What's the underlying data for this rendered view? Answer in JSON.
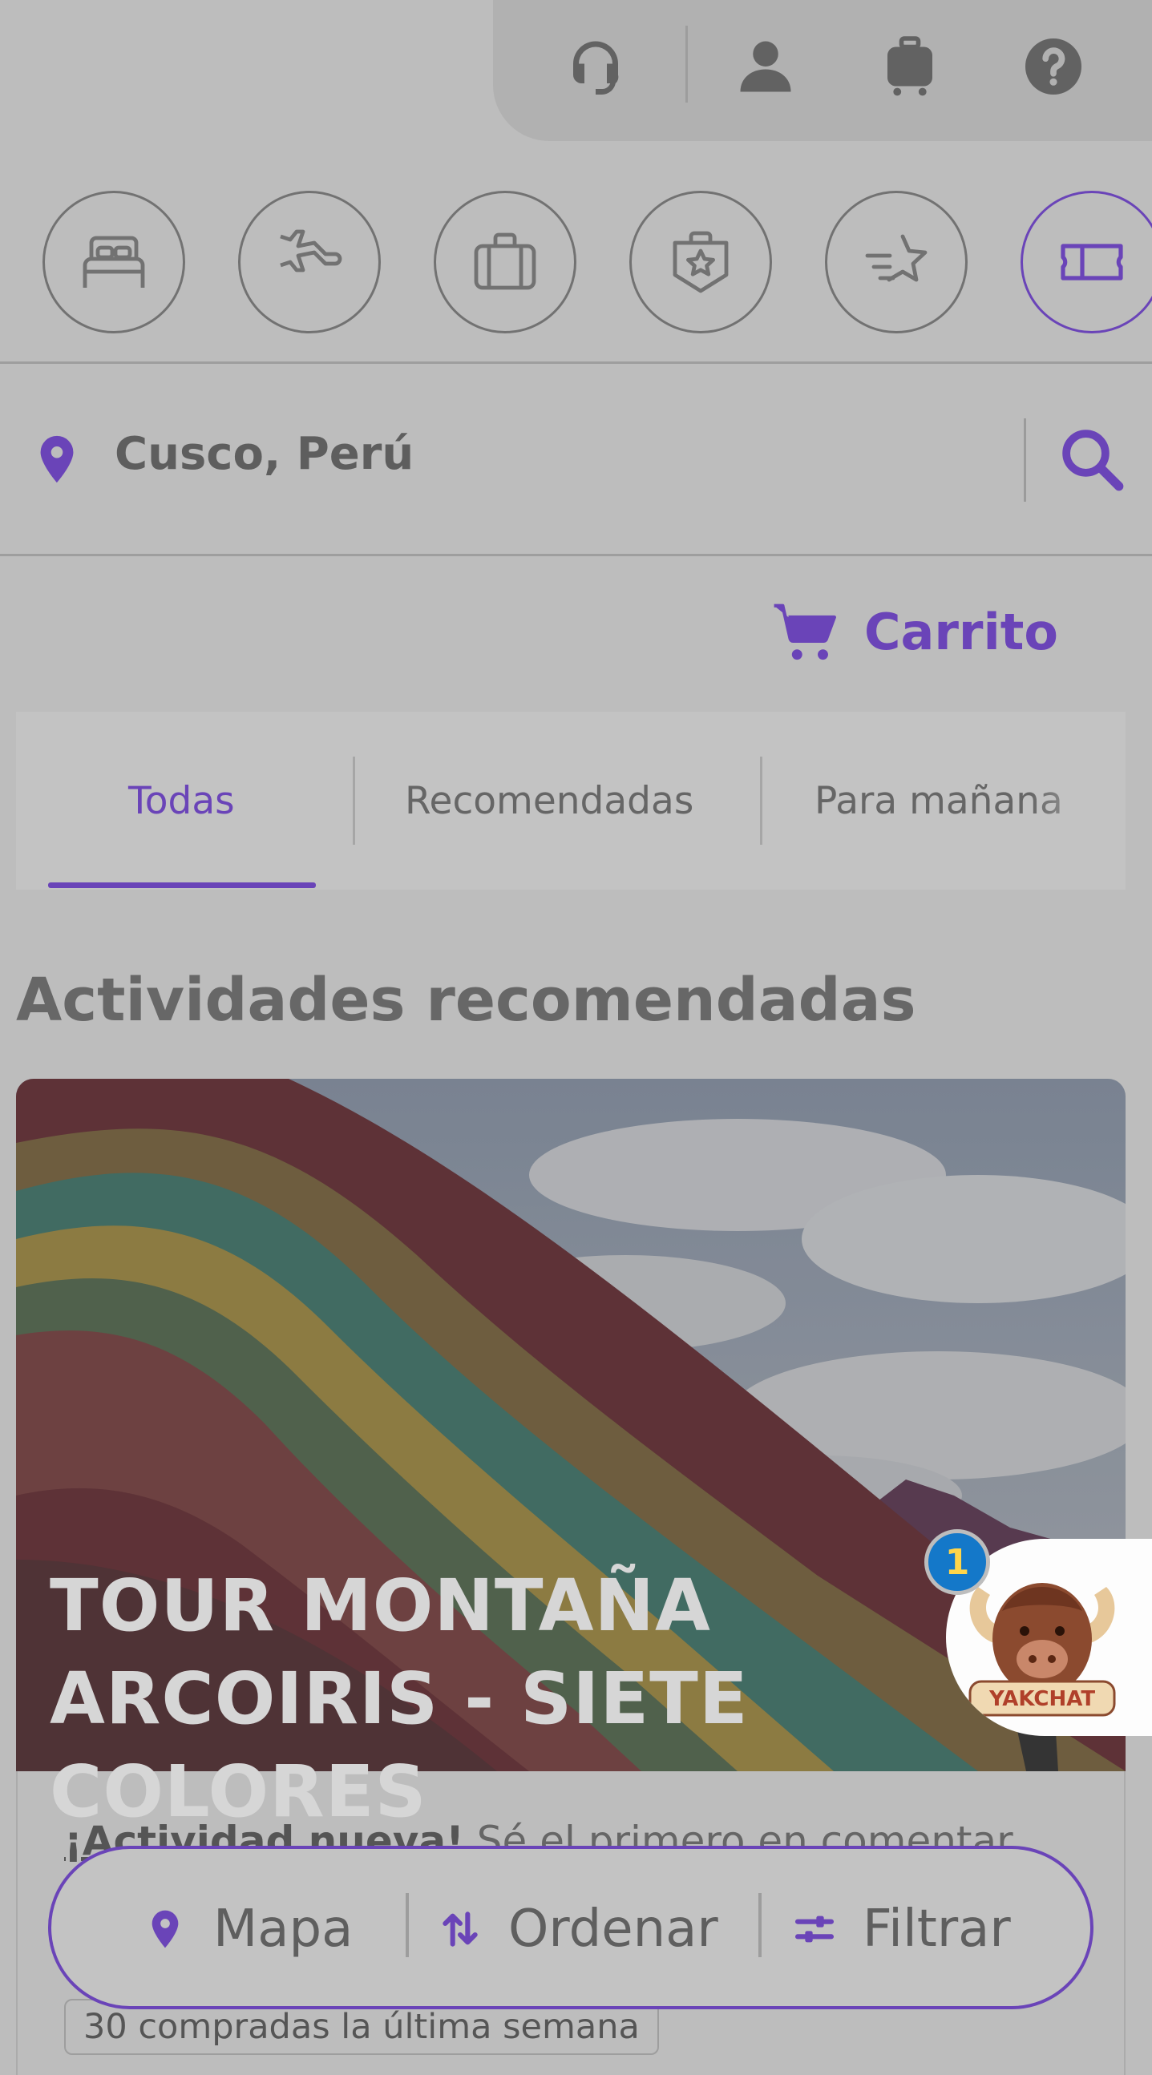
{
  "top_bar": {
    "icons": [
      "headset-icon",
      "user-icon",
      "luggage-icon",
      "help-icon"
    ]
  },
  "categories": [
    {
      "name": "hotels",
      "icon": "bed-icon",
      "active": false
    },
    {
      "name": "flights",
      "icon": "plane-icon",
      "active": false
    },
    {
      "name": "packages",
      "icon": "suitcase-icon",
      "active": false
    },
    {
      "name": "experiences",
      "icon": "badge-star-icon",
      "active": false
    },
    {
      "name": "deals",
      "icon": "star-speed-icon",
      "active": false
    },
    {
      "name": "activities",
      "icon": "ticket-icon",
      "active": true
    }
  ],
  "search": {
    "location": "Cusco, Perú",
    "location_icon": "location-pin-icon",
    "search_icon": "search-icon"
  },
  "cart": {
    "label": "Carrito",
    "icon": "cart-icon"
  },
  "tabs": [
    {
      "label": "Todas",
      "active": true
    },
    {
      "label": "Recomendadas",
      "active": false
    },
    {
      "label": "Para mañana",
      "active": false
    }
  ],
  "section": {
    "title": "Actividades recomendadas"
  },
  "card": {
    "title": "TOUR MONTAÑA ARCOIRIS - SIETE COLORES",
    "new_label": "¡Actividad nueva!",
    "new_text": "Sé el primero en comentar.",
    "bought_badge": "30 compradas la última semana"
  },
  "action_bar": {
    "map": "Mapa",
    "sort": "Ordenar",
    "filter": "Filtrar"
  },
  "chat": {
    "name": "YAKCHAT",
    "badge_count": "1"
  },
  "colors": {
    "accent": "#6a44b8",
    "overlay_gray": "#bdbdbd",
    "badge_blue": "#1478c9"
  }
}
